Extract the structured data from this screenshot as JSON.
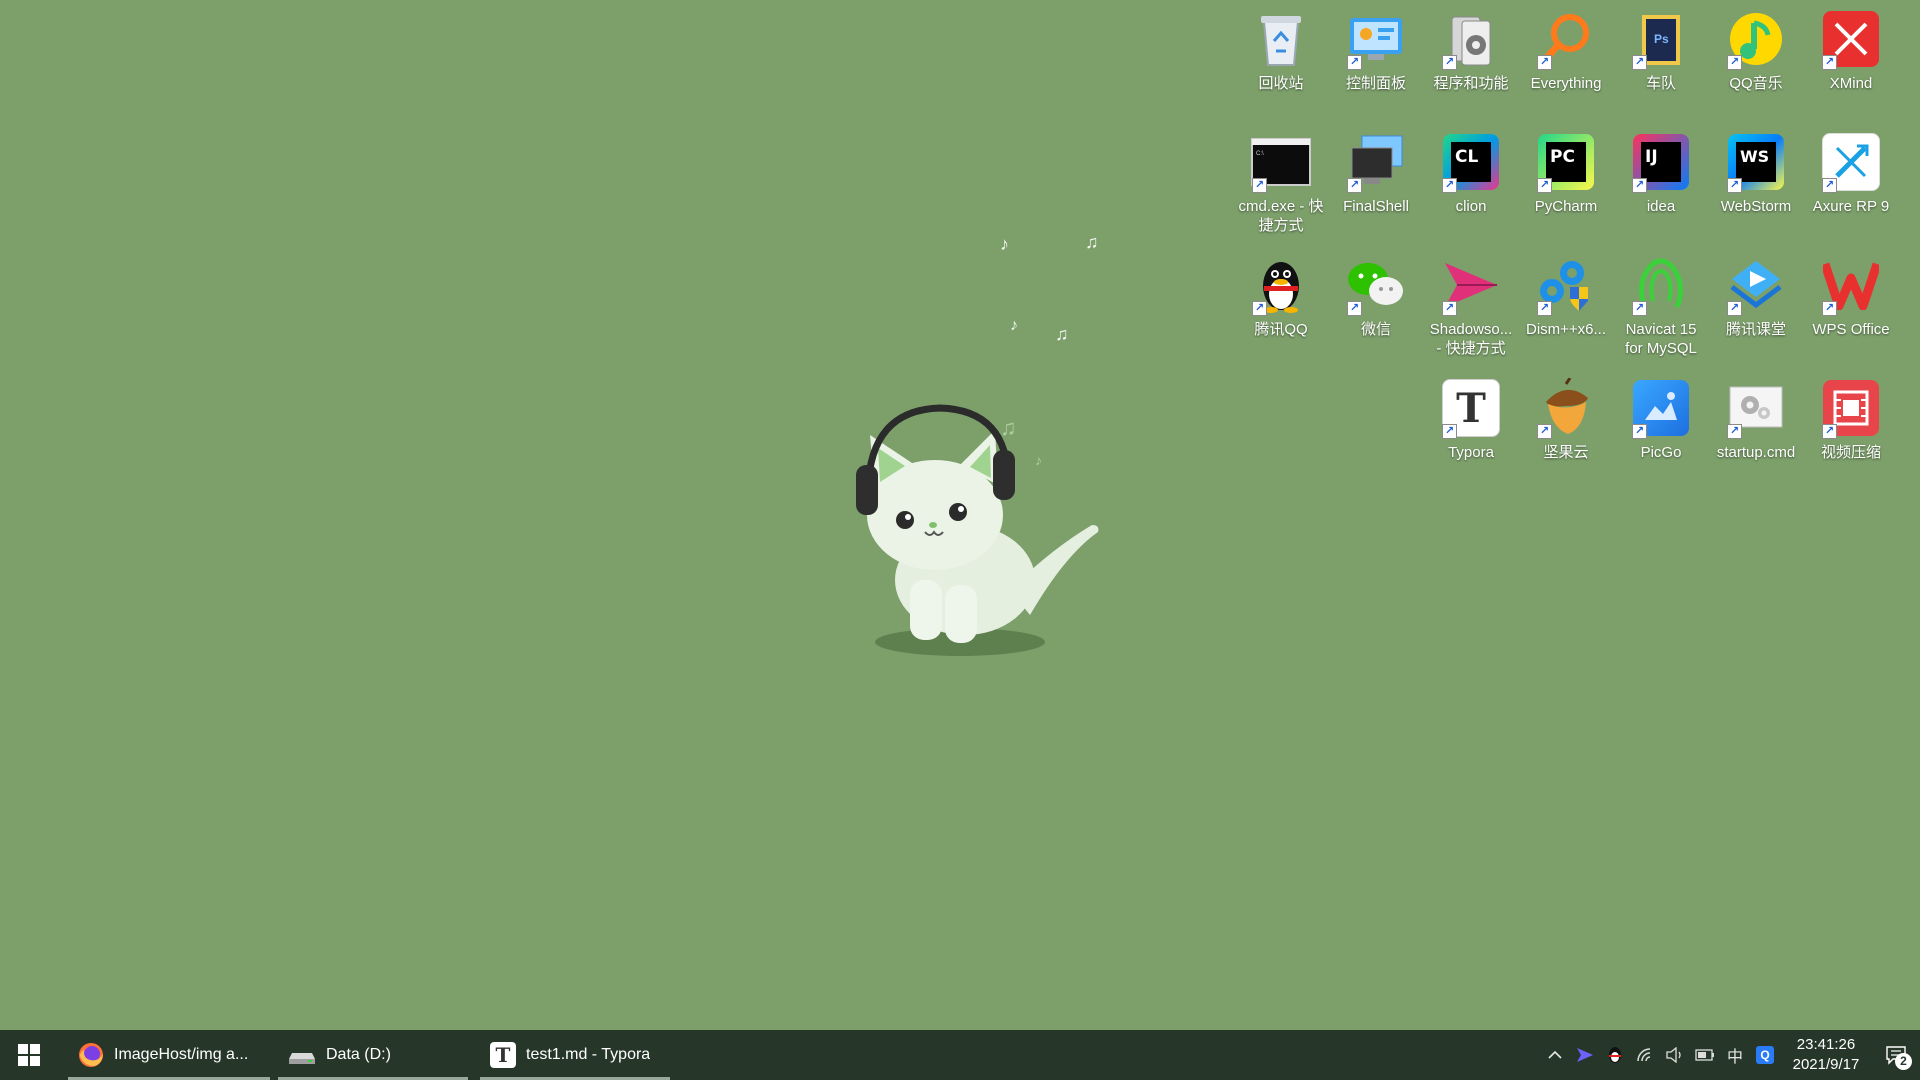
{
  "desktop": {
    "wallpaper_color": "#7da06b",
    "icons": [
      {
        "id": "recycle-bin",
        "label": "回收站",
        "icon": "recycle-bin-icon",
        "shortcut": false
      },
      {
        "id": "control-panel",
        "label": "控制面板",
        "icon": "control-panel-icon",
        "shortcut": true
      },
      {
        "id": "programs-features",
        "label": "程序和功能",
        "icon": "programs-features-icon",
        "shortcut": true
      },
      {
        "id": "everything",
        "label": "Everything",
        "icon": "everything-search-icon",
        "shortcut": true
      },
      {
        "id": "team",
        "label": "车队",
        "icon": "folder-icon",
        "shortcut": true
      },
      {
        "id": "qq-music",
        "label": "QQ音乐",
        "icon": "qq-music-icon",
        "shortcut": true
      },
      {
        "id": "xmind",
        "label": "XMind",
        "icon": "xmind-icon",
        "shortcut": true
      },
      {
        "id": "cmd",
        "label": "cmd.exe - 快\n捷方式",
        "icon": "cmd-icon",
        "shortcut": true
      },
      {
        "id": "finalshell",
        "label": "FinalShell",
        "icon": "finalshell-icon",
        "shortcut": true
      },
      {
        "id": "clion",
        "label": "clion",
        "icon": "clion-icon",
        "shortcut": true
      },
      {
        "id": "pycharm",
        "label": "PyCharm",
        "icon": "pycharm-icon",
        "shortcut": true
      },
      {
        "id": "idea",
        "label": "idea",
        "icon": "intellij-idea-icon",
        "shortcut": true
      },
      {
        "id": "webstorm",
        "label": "WebStorm",
        "icon": "webstorm-icon",
        "shortcut": true
      },
      {
        "id": "axure",
        "label": "Axure RP 9",
        "icon": "axure-icon",
        "shortcut": true
      },
      {
        "id": "tencent-qq",
        "label": "腾讯QQ",
        "icon": "qq-penguin-icon",
        "shortcut": true
      },
      {
        "id": "wechat",
        "label": "微信",
        "icon": "wechat-icon",
        "shortcut": true
      },
      {
        "id": "shadowsocks",
        "label": "Shadowso...\n- 快捷方式",
        "icon": "paper-plane-icon",
        "shortcut": true
      },
      {
        "id": "dism",
        "label": "Dism++x6...",
        "icon": "gears-shield-icon",
        "shortcut": true
      },
      {
        "id": "navicat",
        "label": "Navicat 15\nfor MySQL",
        "icon": "navicat-icon",
        "shortcut": true
      },
      {
        "id": "tencent-classroom",
        "label": "腾讯课堂",
        "icon": "tencent-classroom-icon",
        "shortcut": true
      },
      {
        "id": "wps",
        "label": "WPS Office",
        "icon": "wps-icon",
        "shortcut": true
      },
      {
        "id": "typora",
        "label": "Typora",
        "icon": "typora-icon",
        "shortcut": true
      },
      {
        "id": "jianguoyun",
        "label": "坚果云",
        "icon": "acorn-icon",
        "shortcut": true
      },
      {
        "id": "picgo",
        "label": "PicGo",
        "icon": "picgo-icon",
        "shortcut": true
      },
      {
        "id": "startup-cmd",
        "label": "startup.cmd",
        "icon": "gear-script-icon",
        "shortcut": true
      },
      {
        "id": "video-compress",
        "label": "视频压缩",
        "icon": "film-icon",
        "shortcut": true
      }
    ]
  },
  "taskbar": {
    "start_icon": "windows-logo-icon",
    "tasks": [
      {
        "id": "firefox",
        "label": "ImageHost/img a...",
        "icon": "firefox-icon"
      },
      {
        "id": "explorer",
        "label": "Data (D:)",
        "icon": "drive-icon"
      },
      {
        "id": "typora",
        "label": "test1.md - Typora",
        "icon": "typora-icon"
      }
    ],
    "tray": {
      "ime_label": "中",
      "time": "23:41:26",
      "date": "2021/9/17",
      "notification_count": "2"
    }
  }
}
